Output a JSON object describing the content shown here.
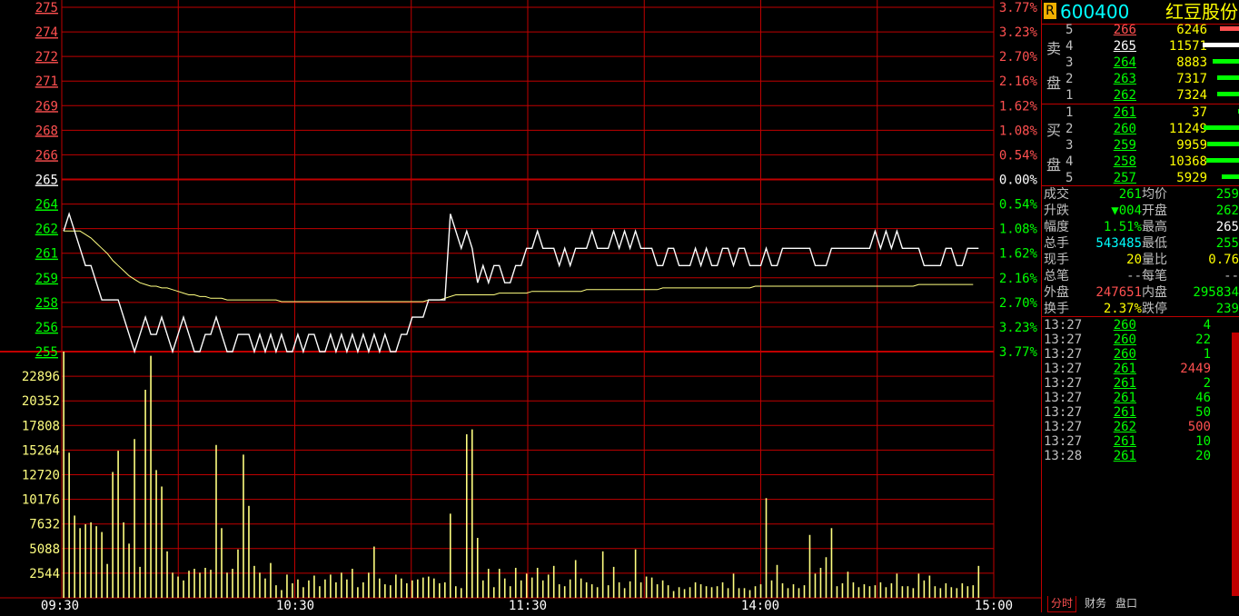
{
  "chart": {
    "price_ticks": [
      "275",
      "274",
      "272",
      "271",
      "269",
      "268",
      "266",
      "265",
      "264",
      "262",
      "261",
      "259",
      "258",
      "256",
      "255"
    ],
    "pct_ticks": [
      "3.77%",
      "3.23%",
      "2.70%",
      "2.16%",
      "1.62%",
      "1.08%",
      "0.54%",
      "0.00%",
      "0.54%",
      "1.08%",
      "1.62%",
      "2.16%",
      "2.70%",
      "3.23%",
      "3.77%"
    ],
    "volume_ticks": [
      "22896",
      "20352",
      "17808",
      "15264",
      "12720",
      "10176",
      "7632",
      "5088",
      "2544"
    ],
    "time_ticks": [
      "09:30",
      "10:30",
      "11:30",
      "14:00",
      "15:00"
    ],
    "colors": {
      "up": "#ff5050",
      "down": "#00ff00",
      "flat": "#ffffff",
      "grid": "#c00000",
      "vol": "#ffff80",
      "avg": "#ffff80",
      "price": "#ffffff"
    }
  },
  "chart_data": {
    "type": "line",
    "title": "",
    "prev_close": 265,
    "price_range": [
      255,
      275
    ],
    "volume_range": [
      0,
      25440
    ],
    "minutes_total": 240,
    "price": [
      262,
      263,
      262,
      261,
      260,
      260,
      259,
      258,
      258,
      258,
      258,
      257,
      256,
      255,
      256,
      257,
      256,
      256,
      257,
      256,
      255,
      256,
      257,
      256,
      255,
      255,
      256,
      256,
      257,
      256,
      255,
      255,
      256,
      256,
      256,
      255,
      256,
      255,
      256,
      255,
      256,
      255,
      255,
      256,
      255,
      256,
      256,
      255,
      255,
      256,
      255,
      256,
      255,
      256,
      255,
      256,
      255,
      256,
      255,
      256,
      255,
      255,
      256,
      256,
      257,
      257,
      257,
      258,
      258,
      258,
      258,
      263,
      262,
      261,
      262,
      261,
      259,
      260,
      259,
      260,
      260,
      259,
      259,
      260,
      260,
      261,
      261,
      262,
      261,
      261,
      261,
      260,
      261,
      260,
      261,
      261,
      261,
      262,
      261,
      261,
      261,
      262,
      261,
      262,
      261,
      262,
      261,
      261,
      261,
      260,
      260,
      261,
      261,
      260,
      260,
      260,
      261,
      260,
      261,
      260,
      260,
      261,
      261,
      260,
      261,
      261,
      260,
      260,
      260,
      261,
      260,
      260,
      261,
      261,
      261,
      261,
      261,
      261,
      260,
      260,
      260,
      261,
      261,
      261,
      261,
      261,
      261,
      261,
      261,
      262,
      261,
      262,
      261,
      262,
      261,
      261,
      261,
      261,
      260,
      260,
      260,
      260,
      261,
      261,
      260,
      260,
      261,
      261,
      261
    ],
    "avg": [
      262,
      262,
      262,
      262,
      261.8,
      261.6,
      261.3,
      261,
      260.7,
      260.3,
      260,
      259.7,
      259.4,
      259.2,
      259,
      258.9,
      258.8,
      258.8,
      258.7,
      258.7,
      258.6,
      258.5,
      258.4,
      258.3,
      258.3,
      258.2,
      258.2,
      258.1,
      258.1,
      258.1,
      258.0,
      258.0,
      258.0,
      258.0,
      258.0,
      258.0,
      258.0,
      258.0,
      258.0,
      258.0,
      257.9,
      257.9,
      257.9,
      257.9,
      257.9,
      257.9,
      257.9,
      257.9,
      257.9,
      257.9,
      257.9,
      257.9,
      257.9,
      257.9,
      257.9,
      257.9,
      257.9,
      257.9,
      257.9,
      257.9,
      257.9,
      257.9,
      257.9,
      257.9,
      257.9,
      257.9,
      257.9,
      258,
      258,
      258,
      258.1,
      258.2,
      258.3,
      258.3,
      258.3,
      258.3,
      258.3,
      258.3,
      258.3,
      258.3,
      258.4,
      258.4,
      258.4,
      258.4,
      258.4,
      258.4,
      258.5,
      258.5,
      258.5,
      258.5,
      258.5,
      258.5,
      258.5,
      258.5,
      258.5,
      258.5,
      258.6,
      258.6,
      258.6,
      258.6,
      258.6,
      258.6,
      258.6,
      258.6,
      258.6,
      258.6,
      258.6,
      258.6,
      258.6,
      258.6,
      258.7,
      258.7,
      258.7,
      258.7,
      258.7,
      258.7,
      258.7,
      258.7,
      258.7,
      258.7,
      258.7,
      258.7,
      258.7,
      258.7,
      258.7,
      258.7,
      258.7,
      258.8,
      258.8,
      258.8,
      258.8,
      258.8,
      258.8,
      258.8,
      258.8,
      258.8,
      258.8,
      258.8,
      258.8,
      258.8,
      258.8,
      258.8,
      258.8,
      258.8,
      258.8,
      258.8,
      258.8,
      258.8,
      258.8,
      258.8,
      258.8,
      258.8,
      258.8,
      258.8,
      258.8,
      258.8,
      258.8,
      258.9,
      258.9,
      258.9,
      258.9,
      258.9,
      258.9,
      258.9,
      258.9,
      258.9,
      258.9,
      258.9
    ],
    "volume": [
      25440,
      15000,
      8500,
      7200,
      7600,
      7800,
      7400,
      6800,
      3500,
      13000,
      15200,
      7800,
      5600,
      16400,
      3200,
      21500,
      25000,
      13200,
      11500,
      4800,
      2600,
      2200,
      1800,
      2800,
      3000,
      2600,
      3100,
      2900,
      15800,
      7200,
      2600,
      3000,
      5000,
      14800,
      9500,
      3300,
      2600,
      2000,
      3600,
      1300,
      800,
      2400,
      1500,
      1900,
      1100,
      1800,
      2300,
      1200,
      1900,
      2400,
      1600,
      2600,
      1900,
      3000,
      1100,
      1600,
      2600,
      5300,
      2000,
      1400,
      1300,
      2400,
      2000,
      1500,
      1800,
      1900,
      2100,
      2200,
      2000,
      1500,
      1600,
      8700,
      1200,
      1000,
      16900,
      17400,
      6200,
      1800,
      3000,
      1100,
      3000,
      2000,
      1200,
      3100,
      1800,
      2500,
      2100,
      3100,
      1800,
      2400,
      3300,
      1400,
      1200,
      1900,
      3900,
      2000,
      1600,
      1400,
      1100,
      4800,
      1300,
      3200,
      1600,
      1000,
      1700,
      5000,
      1600,
      2200,
      2100,
      1400,
      1800,
      1300,
      700,
      1100,
      900,
      1100,
      1600,
      1400,
      1200,
      1100,
      1200,
      1600,
      1000,
      2500,
      1000,
      1000,
      800,
      1200,
      1400,
      10300,
      1800,
      3400,
      1500,
      1000,
      1400,
      1000,
      1300,
      6500,
      2500,
      3100,
      4200,
      7200,
      1200,
      1500,
      2700,
      1600,
      1100,
      1400,
      1200,
      1300,
      1600,
      1100,
      1500,
      2500,
      1200,
      1200,
      1000,
      2500,
      1800,
      2300,
      1200,
      1000,
      1500,
      1100,
      1000,
      1500,
      1200,
      1300,
      3300
    ]
  },
  "panel": {
    "code": "600400",
    "name": "红豆股份",
    "sell_label": [
      "卖",
      "盘"
    ],
    "buy_label": [
      "买",
      "盘"
    ],
    "sell": [
      {
        "lvl": "5",
        "price": "266",
        "vol": "6246",
        "pc": "up",
        "bar": 0.22,
        "bc": "#ff5050"
      },
      {
        "lvl": "4",
        "price": "265",
        "vol": "11571",
        "pc": "flat",
        "bar": 0.41,
        "bc": "#ffffff"
      },
      {
        "lvl": "3",
        "price": "264",
        "vol": "8883",
        "pc": "down",
        "bar": 0.3,
        "bc": "#00ff00"
      },
      {
        "lvl": "2",
        "price": "263",
        "vol": "7317",
        "pc": "down",
        "bar": 0.25,
        "bc": "#00ff00"
      },
      {
        "lvl": "1",
        "price": "262",
        "vol": "7324",
        "pc": "down",
        "bar": 0.25,
        "bc": "#00ff00"
      }
    ],
    "buy": [
      {
        "lvl": "1",
        "price": "261",
        "vol": "37",
        "pc": "down",
        "bar": 0.02,
        "bc": "#00ff00"
      },
      {
        "lvl": "2",
        "price": "260",
        "vol": "11249",
        "pc": "down",
        "bar": 0.4,
        "bc": "#00ff00"
      },
      {
        "lvl": "3",
        "price": "259",
        "vol": "9959",
        "pc": "down",
        "bar": 0.36,
        "bc": "#00ff00"
      },
      {
        "lvl": "4",
        "price": "258",
        "vol": "10368",
        "pc": "down",
        "bar": 0.37,
        "bc": "#00ff00"
      },
      {
        "lvl": "5",
        "price": "257",
        "vol": "5929",
        "pc": "down",
        "bar": 0.2,
        "bc": "#00ff00"
      }
    ],
    "stats": [
      {
        "l1": "成交",
        "v1": "261",
        "c1": "#00ff00",
        "l2": "均价",
        "v2": "259",
        "c2": "#00ff00"
      },
      {
        "l1": "升跌",
        "v1": "▼004",
        "c1": "#00ff00",
        "l2": "开盘",
        "v2": "262",
        "c2": "#00ff00"
      },
      {
        "l1": "幅度",
        "v1": "1.51%",
        "c1": "#00ff00",
        "l2": "最高",
        "v2": "265",
        "c2": "#ffffff"
      },
      {
        "l1": "总手",
        "v1": "543485",
        "c1": "#00ffff",
        "l2": "最低",
        "v2": "255",
        "c2": "#00ff00"
      },
      {
        "l1": "现手",
        "v1": "20",
        "c1": "#ffff00",
        "l2": "量比",
        "v2": "0.76",
        "c2": "#ffff00"
      },
      {
        "l1": "总笔",
        "v1": "--",
        "c1": "#c0c0c0",
        "l2": "每笔",
        "v2": "--",
        "c2": "#c0c0c0"
      },
      {
        "l1": "外盘",
        "v1": "247651",
        "c1": "#ff5050",
        "l2": "内盘",
        "v2": "295834",
        "c2": "#00ff00"
      },
      {
        "l1": "换手",
        "v1": "2.37%",
        "c1": "#ffff00",
        "l2": "跌停",
        "v2": "239",
        "c2": "#00ff00"
      }
    ],
    "ticks": [
      {
        "t": "13:27",
        "p": "260",
        "v": "4",
        "vc": "#00ff00"
      },
      {
        "t": "13:27",
        "p": "260",
        "v": "22",
        "vc": "#00ff00"
      },
      {
        "t": "13:27",
        "p": "260",
        "v": "1",
        "vc": "#00ff00"
      },
      {
        "t": "13:27",
        "p": "261",
        "v": "2449",
        "vc": "#ff5050"
      },
      {
        "t": "13:27",
        "p": "261",
        "v": "2",
        "vc": "#00ff00"
      },
      {
        "t": "13:27",
        "p": "261",
        "v": "46",
        "vc": "#00ff00"
      },
      {
        "t": "13:27",
        "p": "261",
        "v": "50",
        "vc": "#00ff00"
      },
      {
        "t": "13:27",
        "p": "262",
        "v": "500",
        "vc": "#ff5050"
      },
      {
        "t": "13:27",
        "p": "261",
        "v": "10",
        "vc": "#00ff00"
      },
      {
        "t": "13:28",
        "p": "261",
        "v": "20",
        "vc": "#00ff00"
      }
    ],
    "tabs": [
      "分时",
      "财务",
      "盘口"
    ]
  }
}
